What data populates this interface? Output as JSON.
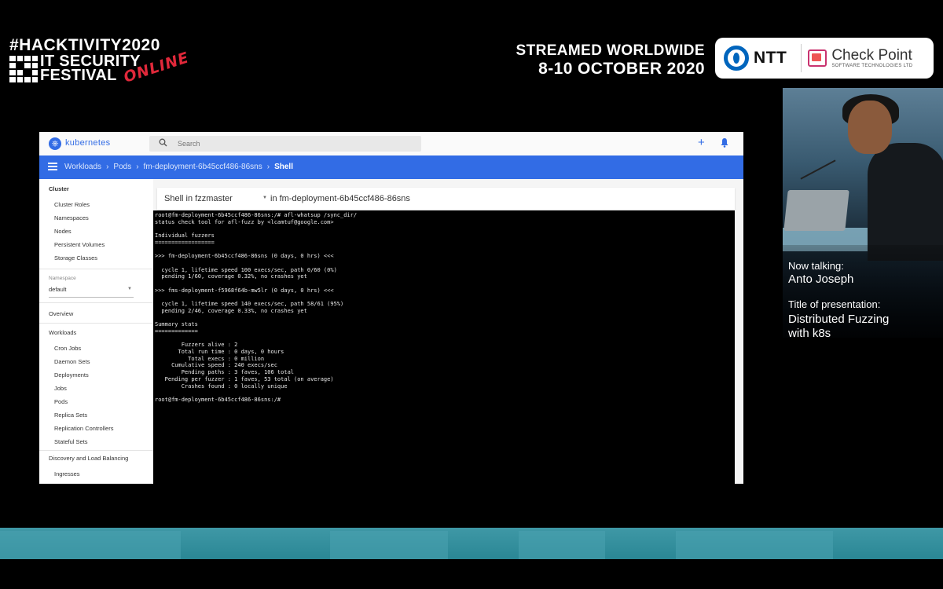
{
  "event": {
    "hashtag": "#HACKTIVITY2020",
    "line1": "IT SECURITY",
    "line2": "FESTIVAL",
    "online": "ONLINE",
    "stream_line1": "STREAMED WORLDWIDE",
    "stream_line2": "8-10 OCTOBER 2020"
  },
  "sponsors": {
    "ntt": "NTT",
    "checkpoint": "Check Point",
    "checkpoint_sub": "SOFTWARE TECHNOLOGIES LTD"
  },
  "colors": {
    "k8s_blue": "#326ce5",
    "band_teal": "#2a8795",
    "online_red": "#e0283a"
  },
  "k8s": {
    "app_title": "kubernetes",
    "search_placeholder": "Search",
    "breadcrumbs": [
      "Workloads",
      "Pods",
      "fm-deployment-6b45ccf486-86sns",
      "Shell"
    ],
    "nav": {
      "cluster_header": "Cluster",
      "cluster_items": [
        "Cluster Roles",
        "Namespaces",
        "Nodes",
        "Persistent Volumes",
        "Storage Classes"
      ],
      "namespace_label": "Namespace",
      "namespace_value": "default",
      "overview": "Overview",
      "workloads": "Workloads",
      "workload_items": [
        "Cron Jobs",
        "Daemon Sets",
        "Deployments",
        "Jobs",
        "Pods",
        "Replica Sets",
        "Replication Controllers",
        "Stateful Sets"
      ],
      "discovery": "Discovery and Load Balancing",
      "discovery_items": [
        "Ingresses"
      ]
    },
    "shell": {
      "container_select": "Shell in fzzmaster",
      "in_pod": "in fm-deployment-6b45ccf486-86sns"
    },
    "terminal_lines": [
      "root@fm-deployment-6b45ccf486-86sns:/# afl-whatsup /sync_dir/",
      "status check tool for afl-fuzz by <lcamtuf@google.com>",
      "",
      "Individual fuzzers",
      "==================",
      "",
      ">>> fm-deployment-6b45ccf486-86sns (0 days, 0 hrs) <<<",
      "",
      "  cycle 1, lifetime speed 100 execs/sec, path 0/60 (0%)",
      "  pending 1/60, coverage 0.32%, no crashes yet",
      "",
      ">>> fms-deployment-f5968f64b-mw5lr (0 days, 0 hrs) <<<",
      "",
      "  cycle 1, lifetime speed 140 execs/sec, path 58/61 (95%)",
      "  pending 2/46, coverage 0.33%, no crashes yet",
      "",
      "Summary stats",
      "=============",
      "",
      "        Fuzzers alive : 2",
      "       Total run time : 0 days, 0 hours",
      "          Total execs : 0 million",
      "     Cumulative speed : 240 execs/sec",
      "        Pending paths : 3 faves, 106 total",
      "   Pending per fuzzer : 1 faves, 53 total (on average)",
      "        Crashes found : 0 locally unique",
      "",
      "root@fm-deployment-6b45ccf486-86sns:/#"
    ]
  },
  "speaker": {
    "now_talking_label": "Now talking:",
    "name": "Anto Joseph",
    "title_label": "Title of presentation:",
    "title_line1": "Distributed Fuzzing",
    "title_line2": "with k8s"
  }
}
